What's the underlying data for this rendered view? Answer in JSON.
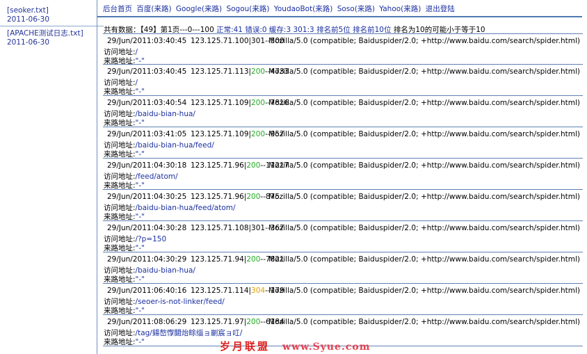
{
  "sidebar": {
    "files": [
      {
        "name": "[seoker.txt]",
        "date": "2011-06-30"
      },
      {
        "name": "[APACHE测试日志.txt]",
        "date": "2011-06-30"
      }
    ]
  },
  "nav": [
    "后台首页",
    "百度(来路)",
    "Google(来路)",
    "Sogou(来路)",
    "YoudaoBot(来路)",
    "Soso(来路)",
    "Yahoo(来路)",
    "退出登陆"
  ],
  "summary": {
    "prefix": "共有数据：【49】第1页---0---100",
    "normal": "正常:41",
    "error": "错误:0",
    "cache": "缓存:3",
    "redirect": "301:3",
    "rank5": "排名前5位",
    "rank10": "排名前10位",
    "suffix": "排名为10的可能小于等于10"
  },
  "labels": {
    "visit": "访问地址:",
    "referer": "来路地址:"
  },
  "entries": [
    {
      "time": "29/Jun/2011:03:40:45",
      "ip": "123.125.71.100|",
      "status": "301",
      "status_color": "b",
      "size": "--500",
      "ua": "Mozilla/5.0 (compatible; Baiduspider/2.0; +http://www.baidu.com/search/spider.html)",
      "path": "/",
      "ref": "\"-\""
    },
    {
      "time": "29/Jun/2011:03:40:45",
      "ip": "123.125.71.113|",
      "status": "200",
      "status_color": "g",
      "size": "--4733",
      "ua": "Mozilla/5.0 (compatible; Baiduspider/2.0; +http://www.baidu.com/search/spider.html)",
      "path": "/",
      "ref": "\"-\""
    },
    {
      "time": "29/Jun/2011:03:40:54",
      "ip": "123.125.71.109|",
      "status": "200",
      "status_color": "g",
      "size": "--7816",
      "ua": "Mozilla/5.0 (compatible; Baiduspider/2.0; +http://www.baidu.com/search/spider.html)",
      "path": "/baidu-bian-hua/",
      "ref": "\"-\""
    },
    {
      "time": "29/Jun/2011:03:41:05",
      "ip": "123.125.71.109|",
      "status": "200",
      "status_color": "g",
      "size": "--957",
      "ua": "Mozilla/5.0 (compatible; Baiduspider/2.0; +http://www.baidu.com/search/spider.html)",
      "path": "/baidu-bian-hua/feed/",
      "ref": "\"-\""
    },
    {
      "time": "29/Jun/2011:04:30:18",
      "ip": "123.125.71.96|",
      "status": "200",
      "status_color": "g",
      "size": "--11217",
      "ua": "Mozilla/5.0 (compatible; Baiduspider/2.0; +http://www.baidu.com/search/spider.html)",
      "path": "/feed/atom/",
      "ref": "\"-\""
    },
    {
      "time": "29/Jun/2011:04:30:25",
      "ip": "123.125.71.96|",
      "status": "200",
      "status_color": "g",
      "size": "--875",
      "ua": "Mozilla/5.0 (compatible; Baiduspider/2.0; +http://www.baidu.com/search/spider.html)",
      "path": "/baidu-bian-hua/feed/atom/",
      "ref": "\"-\""
    },
    {
      "time": "29/Jun/2011:04:30:28",
      "ip": "123.125.71.108|",
      "status": "301",
      "status_color": "b",
      "size": "--367",
      "ua": "Mozilla/5.0 (compatible; Baiduspider/2.0; +http://www.baidu.com/search/spider.html)",
      "path": "/?p=150",
      "ref": "\"-\""
    },
    {
      "time": "29/Jun/2011:04:30:29",
      "ip": "123.125.71.94|",
      "status": "200",
      "status_color": "g",
      "size": "--7821",
      "ua": "Mozilla/5.0 (compatible; Baiduspider/2.0; +http://www.baidu.com/search/spider.html)",
      "path": "/baidu-bian-hua/",
      "ref": "\"-\""
    },
    {
      "time": "29/Jun/2011:06:40:16",
      "ip": "123.125.71.114|",
      "status": "304",
      "status_color": "o",
      "size": "--179",
      "ua": "Mozilla/5.0 (compatible; Baiduspider/2.0; +http://www.baidu.com/search/spider.html)",
      "path": "/seoer-is-not-linker/feed/",
      "ref": "\"-\""
    },
    {
      "time": "29/Jun/2011:08:06:29",
      "ip": "123.125.71.97|",
      "status": "200",
      "status_color": "g",
      "size": "--6184",
      "ua": "Mozilla/5.0 (compatible; Baiduspider/2.0; +http://www.baidu.com/search/spider.html)",
      "path": "/tag/鍚嶅惸閮炲畭缁ョ剻宸ョ叿/",
      "ref": "\"-\""
    }
  ],
  "watermark": {
    "text": "岁月联盟",
    "url": "www.Syue.com"
  }
}
